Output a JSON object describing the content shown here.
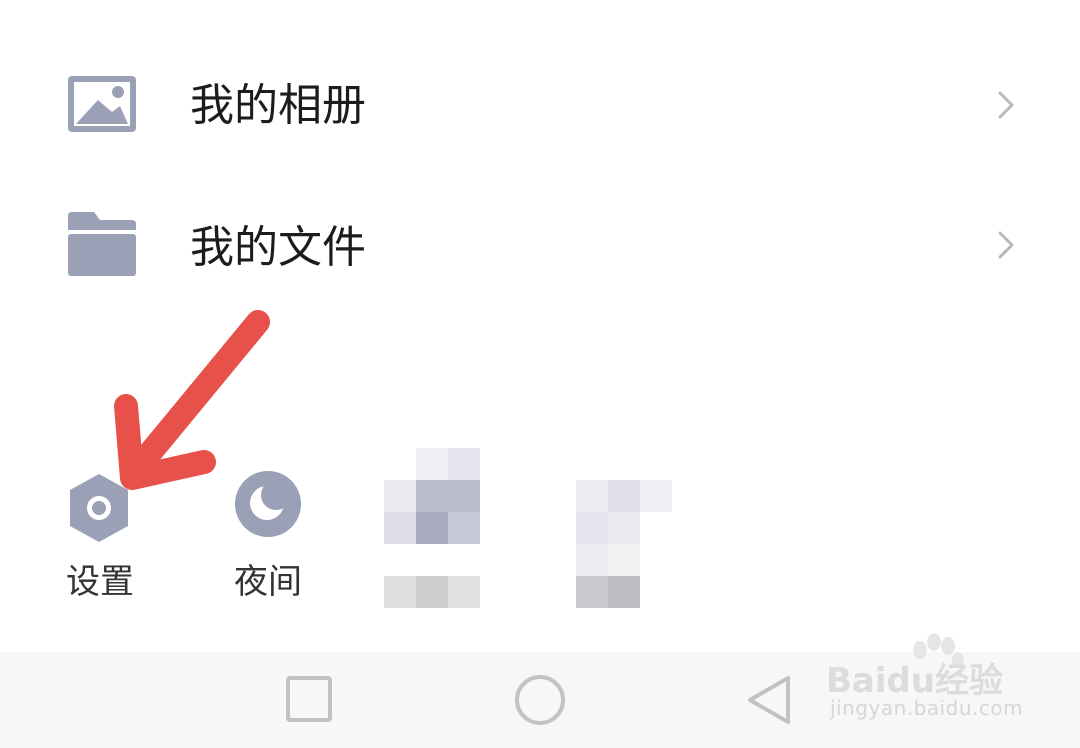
{
  "menu": {
    "items": [
      {
        "label": "我的相册",
        "icon": "photo-album-icon"
      },
      {
        "label": "我的文件",
        "icon": "folder-icon"
      }
    ]
  },
  "tools": [
    {
      "label": "设置",
      "icon": "settings-hexagon-icon"
    },
    {
      "label": "夜间",
      "icon": "night-mode-moon-icon"
    }
  ],
  "navbar": {
    "buttons": [
      "recent-apps-square-icon",
      "home-circle-icon",
      "back-triangle-icon"
    ]
  },
  "watermark": {
    "brand": "Baidu经验",
    "url": "jingyan.baidu.com"
  },
  "colors": {
    "icon": "#9aa0b5",
    "arrow": "#e8504a",
    "chevron": "#b8b8b8"
  }
}
